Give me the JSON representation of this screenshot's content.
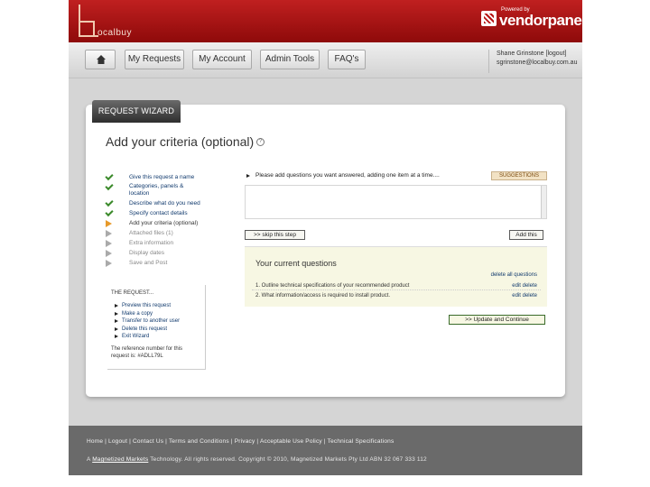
{
  "header": {
    "logo_text": "ocalbuy",
    "powered_by": "Powered by",
    "brand": "vendorpanel"
  },
  "nav": {
    "items": [
      "My Requests",
      "My Account",
      "Admin Tools",
      "FAQ's"
    ]
  },
  "user": {
    "name": "Shane Grinstone",
    "logout": "[logout]",
    "email": "sgrinstone@localbuy.com.au"
  },
  "wizard": {
    "tab_label": "REQUEST WIZARD",
    "title": "Add your criteria (optional)",
    "help": "?"
  },
  "steps": [
    {
      "label": "Give this request a name",
      "status": "done"
    },
    {
      "label": "Categories, panels & location",
      "status": "done"
    },
    {
      "label": "Describe what do you need",
      "status": "done"
    },
    {
      "label": "Specify contact details",
      "status": "done"
    },
    {
      "label": "Add your criteria (optional)",
      "status": "current"
    },
    {
      "label": "Attached files (1)",
      "status": "pending"
    },
    {
      "label": "Extra information",
      "status": "pending"
    },
    {
      "label": "Display dates",
      "status": "pending"
    },
    {
      "label": "Save and Post",
      "status": "pending"
    }
  ],
  "request_box": {
    "heading": "THE REQUEST...",
    "links": [
      "Preview this request",
      "Make a copy",
      "Transfer to another user",
      "Delete this request",
      "Exit Wizard"
    ],
    "ref_line1": "The reference number for this",
    "ref_line2": "request is: #ADLL79L"
  },
  "questions": {
    "prompt": "Please add questions you want answered, adding one item at a time....",
    "suggestions": "SUGGESTIONS",
    "skip": ">> skip this step",
    "add": "Add this",
    "current_title": "Your current questions",
    "delete_all": "delete all questions",
    "items": [
      {
        "text": "1. Outline technical specifications of your recommended product",
        "actions": "edit  delete"
      },
      {
        "text": "2. What information/access is required to install product.",
        "actions": "edit  delete"
      }
    ],
    "update": ">> Update and Continue"
  },
  "footer": {
    "links": "Home | Logout | Contact Us | Terms and Conditions | Privacy | Acceptable Use Policy | Technical Specifications",
    "copy_prefix": "A ",
    "copy_link": "Magnetized Markets",
    "copy_rest": " Technology. All rights reserved. Copyright © 2010, Magnetized Markets Pty Ltd ABN 32 067 333 112"
  }
}
